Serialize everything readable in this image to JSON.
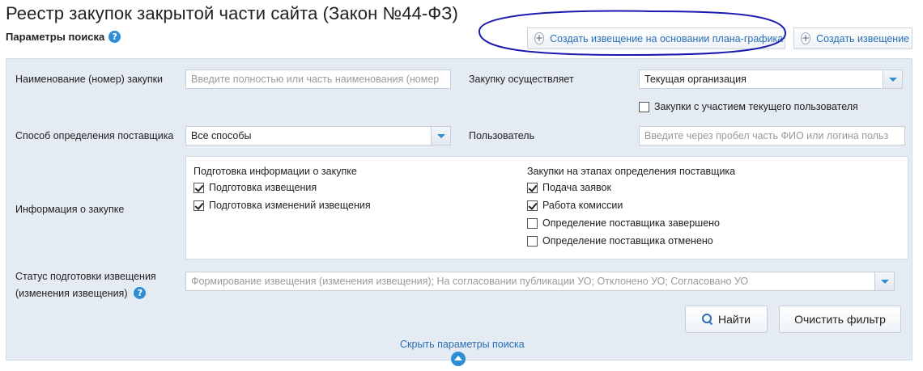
{
  "page": {
    "title": "Реестр закупок закрытой части сайта (Закон №44-ФЗ)",
    "search_params_label": "Параметры поиска",
    "help_glyph": "?"
  },
  "top_buttons": {
    "create_from_plan": "Создать извещение на основании плана-графика",
    "create_notice": "Создать извещение"
  },
  "form": {
    "purchase_name": {
      "label": "Наименование (номер) закупки",
      "placeholder": "Введите полностью или часть наименования (номер"
    },
    "purchaser": {
      "label": "Закупку осуществляет",
      "value": "Текущая организация"
    },
    "with_current_user": {
      "label": "Закупки с участием текущего пользователя",
      "checked": false
    },
    "supplier_method": {
      "label": "Способ определения поставщика",
      "value": "Все способы"
    },
    "user": {
      "label": "Пользователь",
      "placeholder": "Введите через пробел часть ФИО или логина польз"
    },
    "purchase_info": {
      "label": "Информация о закупке",
      "left_group": {
        "title": "Подготовка информации о закупке",
        "items": [
          {
            "label": "Подготовка извещения",
            "checked": true
          },
          {
            "label": "Подготовка изменений извещения",
            "checked": true
          }
        ]
      },
      "right_group": {
        "title": "Закупки на этапах определения поставщика",
        "items": [
          {
            "label": "Подача заявок",
            "checked": true
          },
          {
            "label": "Работа комиссии",
            "checked": true
          },
          {
            "label": "Определение поставщика завершено",
            "checked": false
          },
          {
            "label": "Определение поставщика отменено",
            "checked": false
          }
        ]
      }
    },
    "status": {
      "label_line1": "Статус подготовки извещения",
      "label_line2": "(изменения извещения)",
      "placeholder": "Формирование извещения (изменения извещения); На согласовании публикации УО; Отклонено УО; Согласовано УО"
    }
  },
  "actions": {
    "find": "Найти",
    "clear_filter": "Очистить фильтр",
    "hide_params": "Скрыть параметры поиска"
  },
  "colors": {
    "accent": "#2f8dd6",
    "link": "#2a6fb5",
    "panel_bg": "#e4ebf2",
    "annotation": "#1a1ab0"
  }
}
